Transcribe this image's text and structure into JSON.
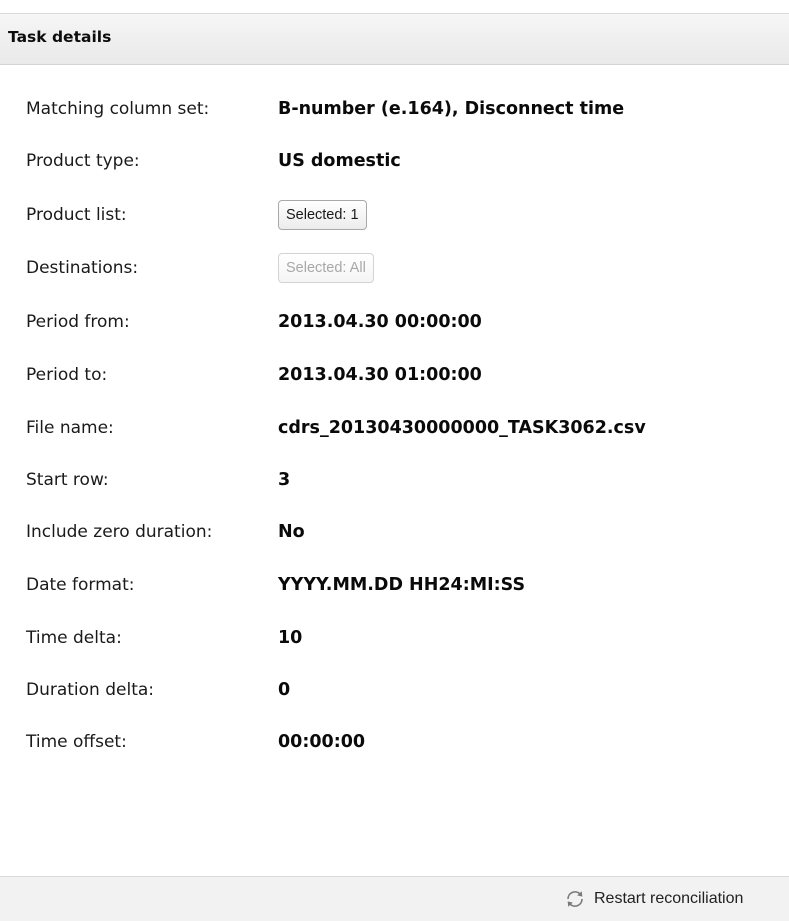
{
  "panel": {
    "title": "Task details"
  },
  "fields": {
    "matching_column_set": {
      "label": "Matching column set:",
      "value": "B-number (e.164), Disconnect time"
    },
    "product_type": {
      "label": "Product type:",
      "value": "US domestic"
    },
    "product_list": {
      "label": "Product list:",
      "button": "Selected: 1"
    },
    "destinations": {
      "label": "Destinations:",
      "button": "Selected: All",
      "disabled": true
    },
    "period_from": {
      "label": "Period from:",
      "value": "2013.04.30 00:00:00"
    },
    "period_to": {
      "label": "Period to:",
      "value": "2013.04.30 01:00:00"
    },
    "file_name": {
      "label": "File name:",
      "value": "cdrs_20130430000000_TASK3062.csv"
    },
    "start_row": {
      "label": "Start row:",
      "value": "3"
    },
    "include_zero_duration": {
      "label": "Include zero duration:",
      "value": "No"
    },
    "date_format": {
      "label": "Date format:",
      "value": "YYYY.MM.DD HH24:MI:SS"
    },
    "time_delta": {
      "label": "Time delta:",
      "value": "10"
    },
    "duration_delta": {
      "label": "Duration delta:",
      "value": "0"
    },
    "time_offset": {
      "label": "Time offset:",
      "value": "00:00:00"
    }
  },
  "footer": {
    "restart_label": "Restart reconciliation",
    "restart_icon": "refresh-icon"
  },
  "colors": {
    "header_bg": "#eeeeee",
    "footer_bg": "#f2f2f2",
    "text": "#1a1a1a"
  }
}
